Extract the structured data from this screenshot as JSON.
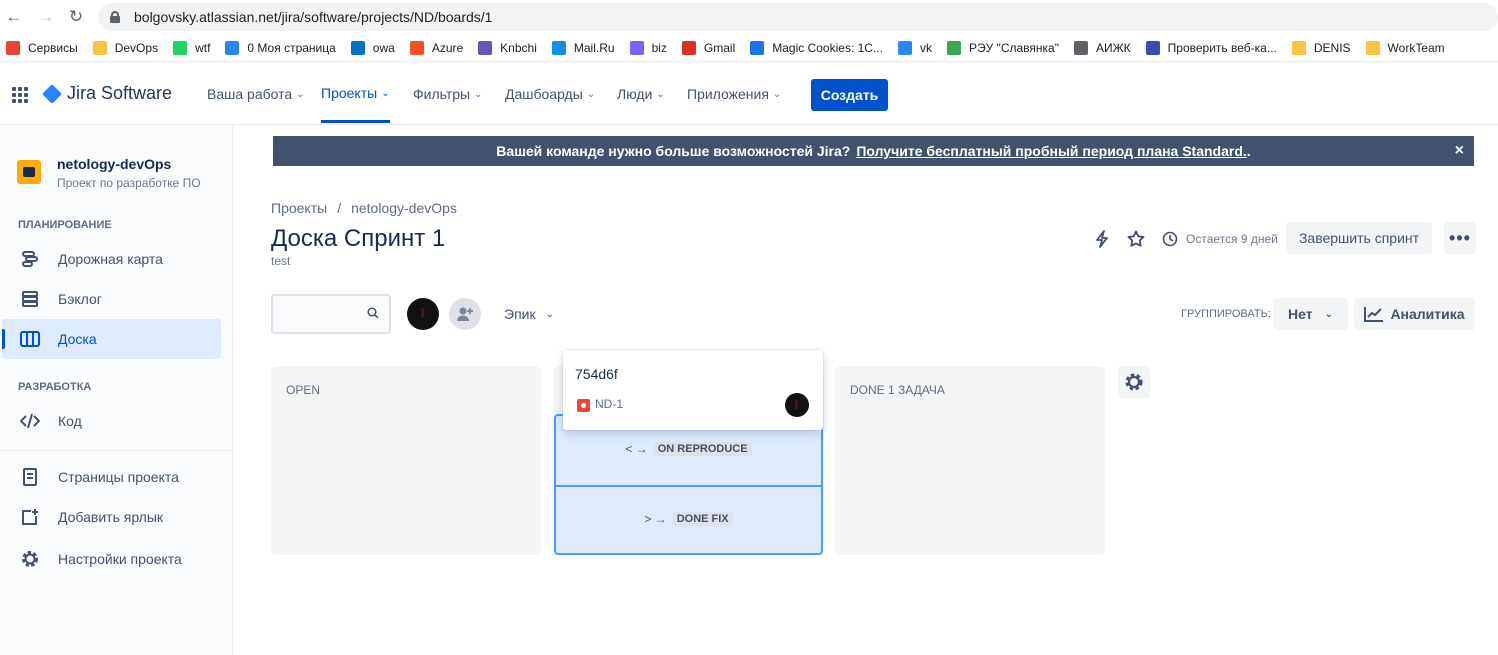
{
  "browser": {
    "url": "bolgovsky.atlassian.net/jira/software/projects/ND/boards/1",
    "bookmarks": [
      {
        "label": "Сервисы",
        "icon": "apps-grid-icon",
        "color": "#ea4335"
      },
      {
        "label": "DevOps",
        "icon": "folder-icon",
        "color": "#f6c445"
      },
      {
        "label": "wtf",
        "icon": "whatsapp-icon",
        "color": "#25d366"
      },
      {
        "label": "0 Моя страница",
        "icon": "vk-icon",
        "color": "#2787f5"
      },
      {
        "label": "owa",
        "icon": "outlook-icon",
        "color": "#0072c6"
      },
      {
        "label": "Azure",
        "icon": "microsoft-icon",
        "color": "#f25022"
      },
      {
        "label": "Knbchi",
        "icon": "k-icon",
        "color": "#6554c0"
      },
      {
        "label": "Mail.Ru",
        "icon": "mailru-icon",
        "color": "#168de2"
      },
      {
        "label": "biz",
        "icon": "chart-icon",
        "color": "#7b61ff"
      },
      {
        "label": "Gmail",
        "icon": "gmail-icon",
        "color": "#d93025"
      },
      {
        "label": "Magic Cookies: 1C...",
        "icon": "cookie-icon",
        "color": "#1a73e8"
      },
      {
        "label": "vk",
        "icon": "vk-icon",
        "color": "#2787f5"
      },
      {
        "label": "РЭУ \"Славянка\"",
        "icon": "leaf-icon",
        "color": "#34a853"
      },
      {
        "label": "АИЖК",
        "icon": "globe-icon",
        "color": "#5f6368"
      },
      {
        "label": "Проверить веб-ка...",
        "icon": "check-icon",
        "color": "#3c4cb5"
      },
      {
        "label": "DENIS",
        "icon": "folder-icon",
        "color": "#f6c445"
      },
      {
        "label": "WorkTeam",
        "icon": "folder-icon",
        "color": "#f6c445"
      }
    ]
  },
  "topnav": {
    "app_name": "Jira Software",
    "menu": [
      "Ваша работа",
      "Проекты",
      "Фильтры",
      "Дашбоарды",
      "Люди",
      "Приложения"
    ],
    "active_menu": "Проекты",
    "create_label": "Создать"
  },
  "sidebar": {
    "project_name": "netology-devOps",
    "project_type": "Проект по разработке ПО",
    "planning_heading": "ПЛАНИРОВАНИЕ",
    "planning_items": [
      "Дорожная карта",
      "Бэклог",
      "Доска"
    ],
    "active_item": "Доска",
    "dev_heading": "РАЗРАБОТКА",
    "dev_items": [
      "Код"
    ],
    "extra_items": [
      "Страницы проекта",
      "Добавить ярлык",
      "Настройки проекта"
    ]
  },
  "banner": {
    "text": "Вашей команде нужно больше возможностей Jira?",
    "link": "Получите бесплатный пробный период плана Standard.",
    "suffix": ".",
    "close": "×"
  },
  "header": {
    "breadcrumb_root": "Проекты",
    "breadcrumb_sep": "/",
    "breadcrumb_project": "netology-devOps",
    "title": "Доска Спринт 1",
    "sprint_goal": "test",
    "remaining": "Остается 9 дней",
    "complete_sprint": "Завершить спринт",
    "more": "•••"
  },
  "toolbar": {
    "search_placeholder": "",
    "epic_label": "Эпик",
    "group_label": "ГРУППИРОВАТЬ:",
    "group_value": "Нет",
    "analytics_label": "Аналитика"
  },
  "board": {
    "columns": [
      "OPEN",
      "",
      "DONE 1 ЗАДАЧА"
    ],
    "transitions": [
      {
        "arrow": "< →",
        "status": "ON REPRODUCE"
      },
      {
        "arrow": "> →",
        "status": "DONE FIX"
      }
    ],
    "card": {
      "summary": "754d6f",
      "key": "ND-1",
      "type_color": "#e5493a"
    }
  },
  "colors": {
    "accent": "#0052cc",
    "banner_bg": "#42526e",
    "drop_zone": "#deebff",
    "drop_border": "#4c9aff"
  }
}
